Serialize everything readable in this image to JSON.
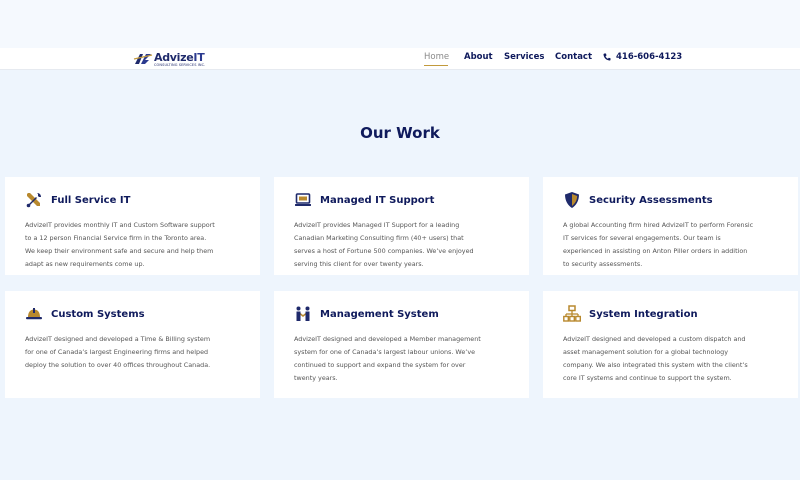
{
  "header": {
    "logo": {
      "name": "AdvizeIT",
      "name_part1": "Advize",
      "name_part2": "IT",
      "subtitle": "CONSULTING SERVICES INC."
    },
    "nav": [
      {
        "label": "Home",
        "active": true
      },
      {
        "label": "About",
        "active": false
      },
      {
        "label": "Services",
        "active": false
      },
      {
        "label": "Contact",
        "active": false
      }
    ],
    "phone": {
      "icon": "phone-icon",
      "number": "416-606-4123"
    }
  },
  "section": {
    "title": "Our Work"
  },
  "cards": [
    {
      "icon": "tools-icon",
      "title": "Full Service IT",
      "lines": [
        "AdvizeIT provides monthly IT and Custom Software support",
        "to a 12 person Financial Service firm in the Toronto area.",
        "We keep their environment safe and secure and help them",
        "adapt as new requirements come up."
      ]
    },
    {
      "icon": "laptop-icon",
      "title": "Managed IT Support",
      "lines": [
        "AdvizeIT provides Managed IT Support for a leading",
        "Canadian Marketing Consulting firm (40+ users) that",
        "serves a host of Fortune 500 companies. We’ve enjoyed",
        "serving this client for over twenty years."
      ]
    },
    {
      "icon": "shield-icon",
      "title": "Security Assessments",
      "lines": [
        "A global Accounting firm hired AdvizeIT to perform Forensic",
        "IT services for several engagements. Our team is",
        "experienced in assisting on Anton Piller orders in addition",
        "to security assessments."
      ]
    },
    {
      "icon": "hard-hat-icon",
      "title": "Custom Systems",
      "lines": [
        "AdvizeIT designed and developed a Time & Billing system",
        "for one of Canada’s largest Engineering firms and helped",
        "deploy the solution to over 40 offices throughout Canada."
      ]
    },
    {
      "icon": "people-handshake-icon",
      "title": "Management System",
      "lines": [
        "AdvizeIT designed and developed a Member management",
        "system for one of Canada’s largest labour unions. We’ve",
        "continued to support and expand the system for over",
        "twenty years."
      ]
    },
    {
      "icon": "network-icon",
      "title": "System Integration",
      "lines": [
        "AdvizeIT designed and developed a custom dispatch and",
        "asset management solution for a global technology",
        "company. We also integrated this system with the client’s",
        "core IT systems and continue to support the system."
      ]
    }
  ],
  "colors": {
    "navy": "#0f1a5c",
    "gold": "#b8892e",
    "page_bg": "#eef5fd",
    "card_bg": "#ffffff",
    "body_text": "#555555"
  }
}
